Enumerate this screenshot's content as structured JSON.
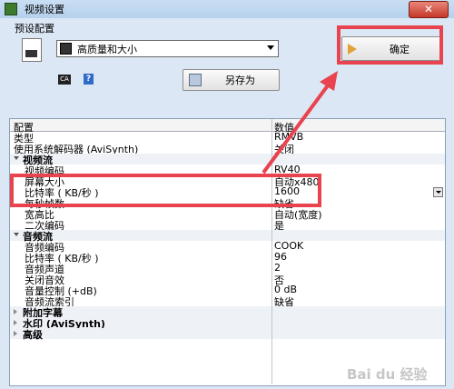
{
  "window": {
    "title": "视频设置",
    "close": "✕"
  },
  "preset": {
    "label": "预设配置",
    "selected": "高质量和大小",
    "ok": "确定",
    "save_as": "另存为",
    "icon1": "CA"
  },
  "table": {
    "col_name": "配置",
    "col_value": "数值",
    "rows": [
      {
        "name": "类型",
        "value": "RMVB",
        "kind": "plain"
      },
      {
        "name": "使用系统解码器 (AviSynth)",
        "value": "关闭",
        "kind": "plain"
      },
      {
        "name": "视频流",
        "value": "",
        "kind": "cat"
      },
      {
        "name": "视频编码",
        "value": "RV40",
        "kind": "sub"
      },
      {
        "name": "屏幕大小",
        "value": "自动x480",
        "kind": "sub"
      },
      {
        "name": "比特率 ( KB/秒 )",
        "value": "1600",
        "kind": "sub"
      },
      {
        "name": "每秒帧数",
        "value": "缺省",
        "kind": "sub"
      },
      {
        "name": "宽高比",
        "value": "自动(宽度)",
        "kind": "sub"
      },
      {
        "name": "二次编码",
        "value": "是",
        "kind": "sub"
      },
      {
        "name": "音频流",
        "value": "",
        "kind": "cat"
      },
      {
        "name": "音频编码",
        "value": "COOK",
        "kind": "sub"
      },
      {
        "name": "比特率 ( KB/秒 )",
        "value": "96",
        "kind": "sub"
      },
      {
        "name": "音频声道",
        "value": "2",
        "kind": "sub"
      },
      {
        "name": "关闭音效",
        "value": "否",
        "kind": "sub"
      },
      {
        "name": "音量控制 (+dB)",
        "value": "0 dB",
        "kind": "sub"
      },
      {
        "name": "音频流索引",
        "value": "缺省",
        "kind": "sub"
      },
      {
        "name": "附加字幕",
        "value": "",
        "kind": "cat-collapsed"
      },
      {
        "name": "水印 (AviSynth)",
        "value": "",
        "kind": "cat-collapsed"
      },
      {
        "name": "高级",
        "value": "",
        "kind": "cat-collapsed"
      }
    ]
  },
  "watermark": "Bai du 经验",
  "colors": {
    "highlight": "#e8434f",
    "titlebar": "#b6d1ec"
  }
}
